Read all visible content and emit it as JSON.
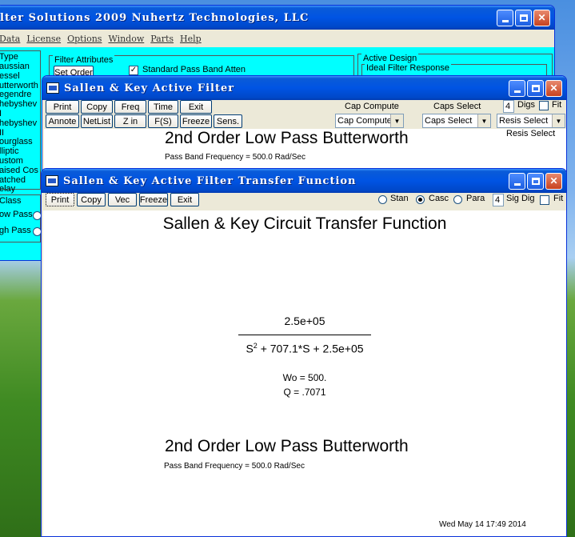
{
  "main": {
    "title": "lter Solutions 2009      Nuhertz Technologies, LLC",
    "menu": [
      "Data",
      "License",
      "Options",
      "Window",
      "Parts",
      "Help"
    ],
    "type_group": "Type",
    "types": [
      "aussian",
      "essel",
      "utterworth",
      "egendre",
      "hebyshev I",
      "hebyshev II",
      "ourglass",
      "lliptic",
      "ustom",
      "aised Cos",
      "atched",
      "elay"
    ],
    "class_group": "Class",
    "classes": [
      "ow Pass",
      "gh Pass"
    ],
    "filter_attributes": "Filter Attributes",
    "set_order": "Set Order",
    "standard_pass_band": "Standard Pass Band Atten",
    "active_design": "Active Design",
    "ideal_response": "Ideal Filter Response"
  },
  "mid": {
    "title": "Sallen & Key Active Filter",
    "row1": [
      "Print",
      "Copy",
      "Freq",
      "Time",
      "Exit"
    ],
    "row2": [
      "Annote",
      "NetList",
      "Z in",
      "F(S)",
      "Freeze",
      "Sens."
    ],
    "cap_compute_label": "Cap Compute",
    "cap_compute_value": "Cap Compute",
    "caps_select_label": "Caps Select",
    "caps_select_value": "Caps Select",
    "digs_value": "4",
    "digs_label": "Digs",
    "fit_label": "Fit",
    "resis_select_value": "Resis Select",
    "resis_select_label": "Resis Select",
    "heading": "2nd Order Low Pass Butterworth",
    "subheading": "Pass Band Frequency = 500.0 Rad/Sec"
  },
  "front": {
    "title": "Sallen & Key Active Filter Transfer Function",
    "buttons": [
      "Print",
      "Copy",
      "Vec",
      "Freeze",
      "Exit"
    ],
    "radios": [
      "Stan",
      "Casc",
      "Para"
    ],
    "sig_dig_value": "4",
    "sig_dig_label": "Sig Dig",
    "fit_label": "Fit",
    "heading": "Sallen & Key Circuit Transfer Function",
    "numerator": "2.5e+05",
    "denom_s": "S",
    "denom_exp": "2",
    "denom_rest": " + 707.1*S + 2.5e+05",
    "wo": "Wo = 500.",
    "q": "Q = .7071",
    "heading2": "2nd Order Low Pass Butterworth",
    "subheading2": "Pass Band Frequency = 500.0 Rad/Sec",
    "timestamp": "Wed May 14 17:49 2014"
  },
  "colors": {
    "cyan": "#00ffff",
    "titlebar": "#0054e3",
    "close": "#c8421f"
  }
}
